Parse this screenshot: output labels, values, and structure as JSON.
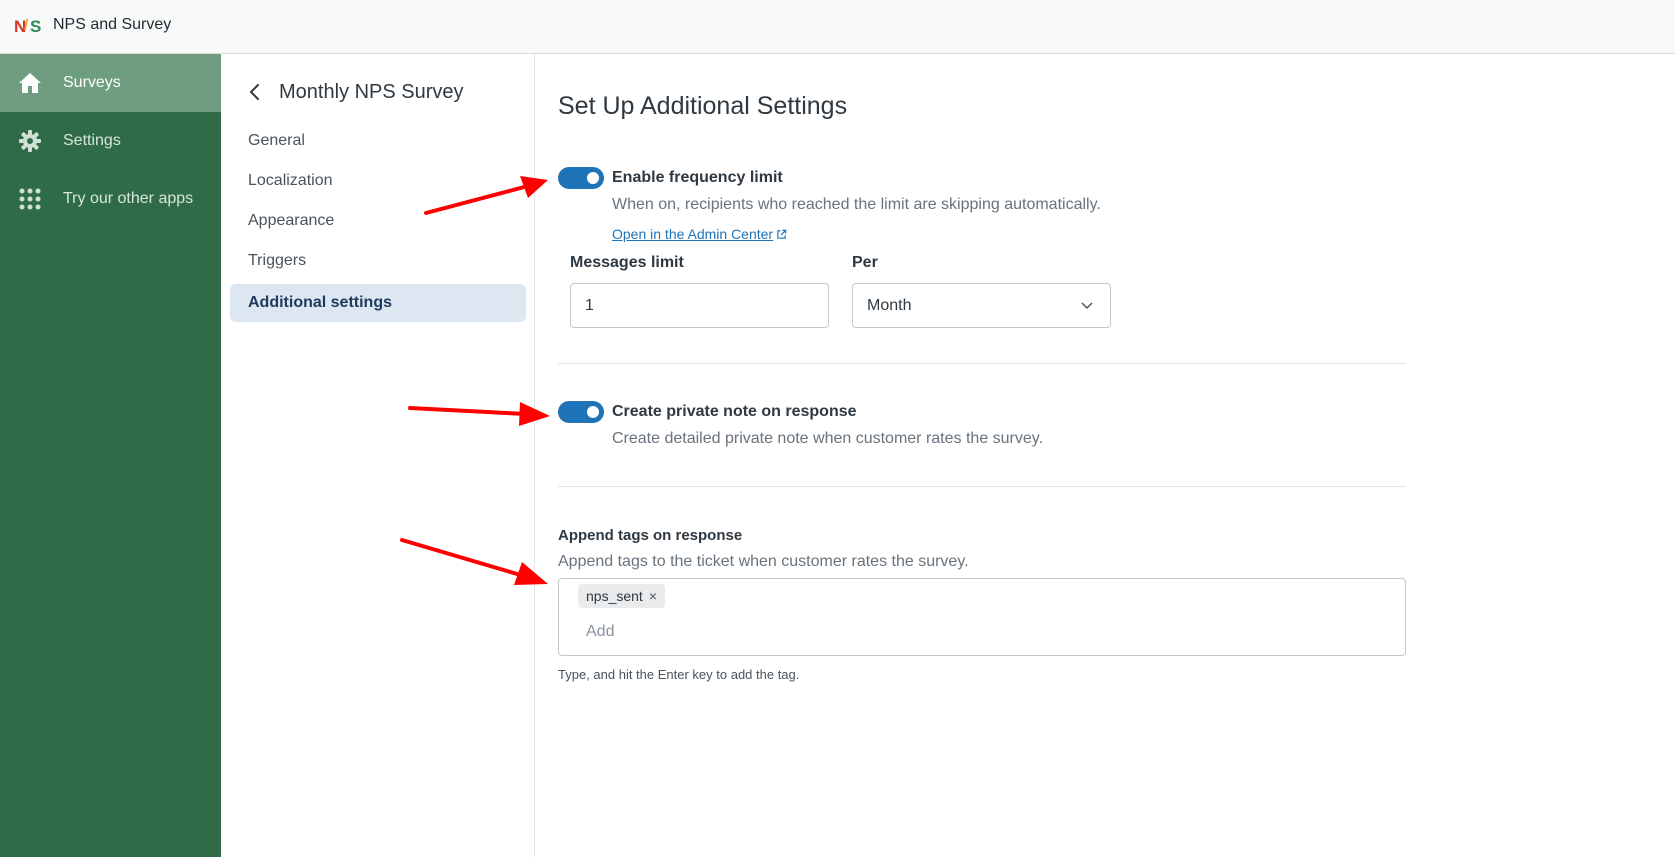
{
  "app": {
    "title": "NPS and Survey"
  },
  "leftnav": {
    "items": [
      {
        "label": "Surveys",
        "icon": "home-icon",
        "active": true
      },
      {
        "label": "Settings",
        "icon": "gear-icon",
        "active": false
      },
      {
        "label": "Try our other apps",
        "icon": "grid-icon",
        "active": false
      }
    ]
  },
  "subnav": {
    "title": "Monthly NPS Survey",
    "items": [
      {
        "label": "General"
      },
      {
        "label": "Localization"
      },
      {
        "label": "Appearance"
      },
      {
        "label": "Triggers"
      },
      {
        "label": "Additional settings",
        "active": true
      }
    ]
  },
  "main": {
    "title": "Set Up Additional Settings",
    "frequency": {
      "enabled": true,
      "label": "Enable frequency limit",
      "hint": "When on, recipients who reached the limit are skipping automatically.",
      "link": "Open in the Admin Center",
      "messages_limit_label": "Messages limit",
      "messages_limit_value": "1",
      "per_label": "Per",
      "per_value": "Month"
    },
    "private_note": {
      "enabled": true,
      "label": "Create private note on response",
      "hint": "Create detailed private note when customer rates the survey."
    },
    "tags": {
      "label": "Append tags on response",
      "hint": "Append tags to the ticket when customer rates the survey.",
      "items": [
        "nps_sent"
      ],
      "remove_glyph": "×",
      "placeholder": "Add",
      "help": "Type, and hit the Enter key to add the tag."
    }
  },
  "colors": {
    "nav_bg": "#2f6b47",
    "nav_active": "#6e9e7f",
    "toggle_on": "#1f73b7",
    "link": "#1f73b7",
    "annotation_arrow": "#ff0000"
  }
}
